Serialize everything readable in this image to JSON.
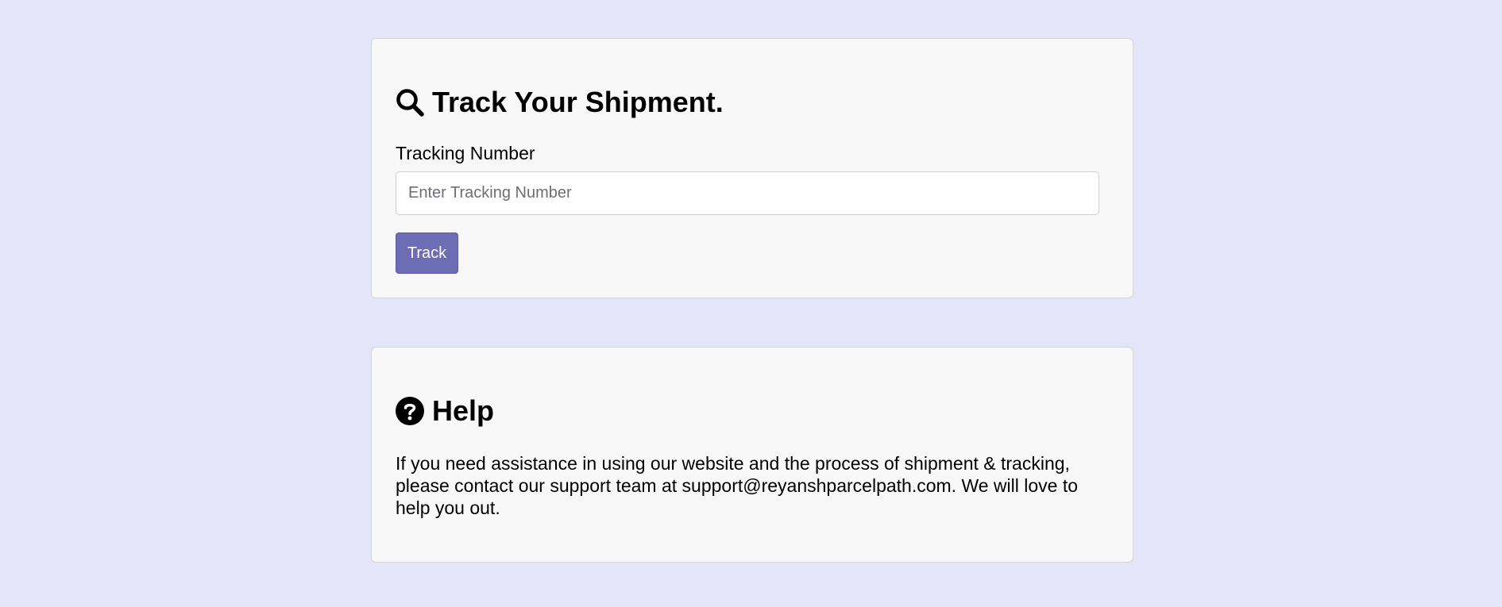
{
  "track": {
    "icon": "search-icon",
    "title": "Track Your Shipment.",
    "label": "Tracking Number",
    "placeholder": "Enter Tracking Number",
    "value": "",
    "button_label": "Track",
    "button_color": "#6c6db4"
  },
  "help": {
    "icon": "question-circle-icon",
    "title": "Help",
    "text": "If you need assistance in using our website and the process of shipment & tracking, please contact our support team at support@reyanshparcelpath.com. We will love to help you out."
  },
  "colors": {
    "background": "#e5e5f9",
    "card": "#f8f8f8",
    "accent": "#6c6db4"
  }
}
